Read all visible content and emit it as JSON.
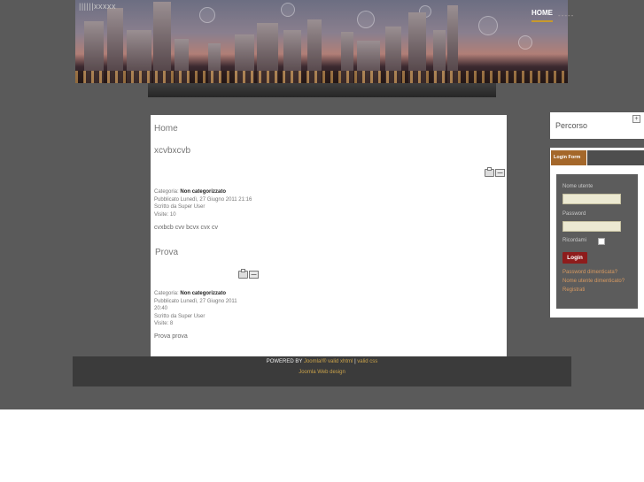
{
  "header": {
    "logo_text": "||||||xxxxx",
    "nav": {
      "home": "HOME",
      "other": "-----"
    }
  },
  "article1": {
    "page_heading": "Home",
    "title": "xcvbxcvb",
    "category_label": "Categoria:",
    "category_value": "Non categorizzato",
    "published": "Pubblicato Lunedì, 27 Giugno 2011 21:16",
    "author": "Scritto da Super User",
    "hits": "Visite: 10",
    "body": "cvxbcb cvv bcvx cvx cv"
  },
  "article2": {
    "title": "Prova",
    "category_label": "Categoria:",
    "category_value": "Non categorizzato",
    "published_1": "Pubblicato Lunedì, 27 Giugno 2011",
    "published_2": "20:40",
    "author": "Scritto da Super User",
    "hits": "Visite: 8",
    "body": "Prova prova"
  },
  "footer": {
    "powered": "POWERED BY",
    "link1": "Joomla!®",
    "link2": "valid xhtml",
    "sep": "|",
    "link3": "valid css",
    "design": "Joomla Web design"
  },
  "sidebar": {
    "percorso_title": "Percorso",
    "percorso_toggle": "+",
    "login": {
      "tab": "Login Form",
      "username_label": "Nome utente",
      "password_label": "Password",
      "remember_label": "Ricordami",
      "button": "Login",
      "forgot_password": "Password dimenticata?",
      "forgot_username": "Nome utente dimenticato?",
      "register": "Registrati"
    }
  },
  "colors": {
    "background": "#5a5a5a",
    "accent": "#c89a2c",
    "login_button": "#8e1c1c",
    "login_tab": "#a4672a"
  }
}
